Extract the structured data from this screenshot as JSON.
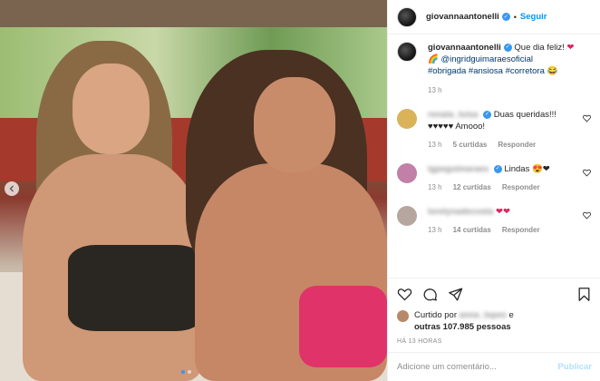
{
  "post": {
    "image_alt": "",
    "carousel_dots": 2,
    "active_dot": 0
  },
  "header": {
    "username": "giovannaantonelli",
    "follow_label": "Seguir",
    "separator": "•"
  },
  "caption": {
    "username": "giovannaantonelli",
    "text_1": " Que dia feliz! ",
    "emoji_1": "❤",
    "emoji_2": "🌈 ",
    "mention": "@ingridguimaraesoficial",
    "tags": [
      "#obrigada",
      "#ansiosa",
      "#corretora"
    ],
    "emoji_3": " 😂",
    "time": "13 h"
  },
  "comments": [
    {
      "username": "renata_luisa",
      "text": "Duas queridas!!! ♥♥♥♥♥ Amooo!",
      "time": "13 h",
      "likes": "5 curtidas",
      "reply": "Responder",
      "avatar_color": "#d9b25a"
    },
    {
      "username": "igpeguimaraes",
      "text": "Lindas 😍❤",
      "time": "13 h",
      "likes": "12 curtidas",
      "reply": "Responder",
      "avatar_color": "#c27fa8"
    },
    {
      "username": "lorelynadecosta",
      "text": "❤❤",
      "time": "13 h",
      "likes": "14 curtidas",
      "reply": "Responder",
      "avatar_color": "#b7a6a0"
    }
  ],
  "likes": {
    "prefix": "Curtido por ",
    "blurred_user": "anna_lopes",
    "conj": " e",
    "others": "outras 107.985 pessoas"
  },
  "posted_ago": "HÁ 13 HORAS",
  "add_comment": {
    "placeholder": "Adicione um comentário...",
    "publish_label": "Publicar"
  },
  "colors": {
    "accent": "#0095f6",
    "link": "#00376b",
    "muted": "#8e8e8e",
    "publish_disabled": "#b2dffc"
  }
}
